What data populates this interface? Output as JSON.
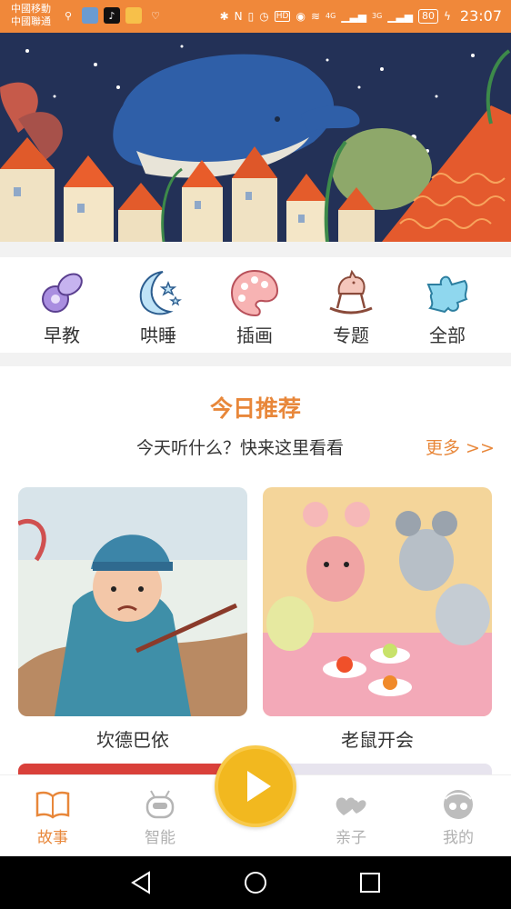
{
  "status_bar": {
    "carrier_1": "中國移動",
    "carrier_2": "中國聯通",
    "network_1": "4G",
    "network_2": "3G",
    "battery": "80",
    "time": "23:07",
    "nfc": "N",
    "hd": "HD"
  },
  "categories": [
    {
      "label": "早教",
      "icon": "pacifier-icon",
      "color": "#9b7fd4"
    },
    {
      "label": "哄睡",
      "icon": "moon-stars-icon",
      "color": "#4a8fd0"
    },
    {
      "label": "插画",
      "icon": "palette-icon",
      "color": "#f39a9a"
    },
    {
      "label": "专题",
      "icon": "rocking-horse-icon",
      "color": "#d98b7a"
    },
    {
      "label": "全部",
      "icon": "puzzle-icon",
      "color": "#5cc3e0"
    }
  ],
  "recommend": {
    "title": "今日推荐",
    "subtitle": "今天听什么？快来这里看看",
    "more": "更多 >>"
  },
  "cards": [
    {
      "title": "坎德巴依"
    },
    {
      "title": "老鼠开会"
    }
  ],
  "bottom_nav": {
    "items": [
      {
        "label": "故事",
        "icon": "book-icon",
        "active": true
      },
      {
        "label": "智能",
        "icon": "robot-icon",
        "active": false
      },
      {
        "label": "亲子",
        "icon": "hearts-icon",
        "active": false
      },
      {
        "label": "我的",
        "icon": "profile-icon",
        "active": false
      }
    ]
  },
  "colors": {
    "accent": "#e8873a",
    "status_bar": "#f0883a",
    "play_button": "#f2b81f"
  }
}
